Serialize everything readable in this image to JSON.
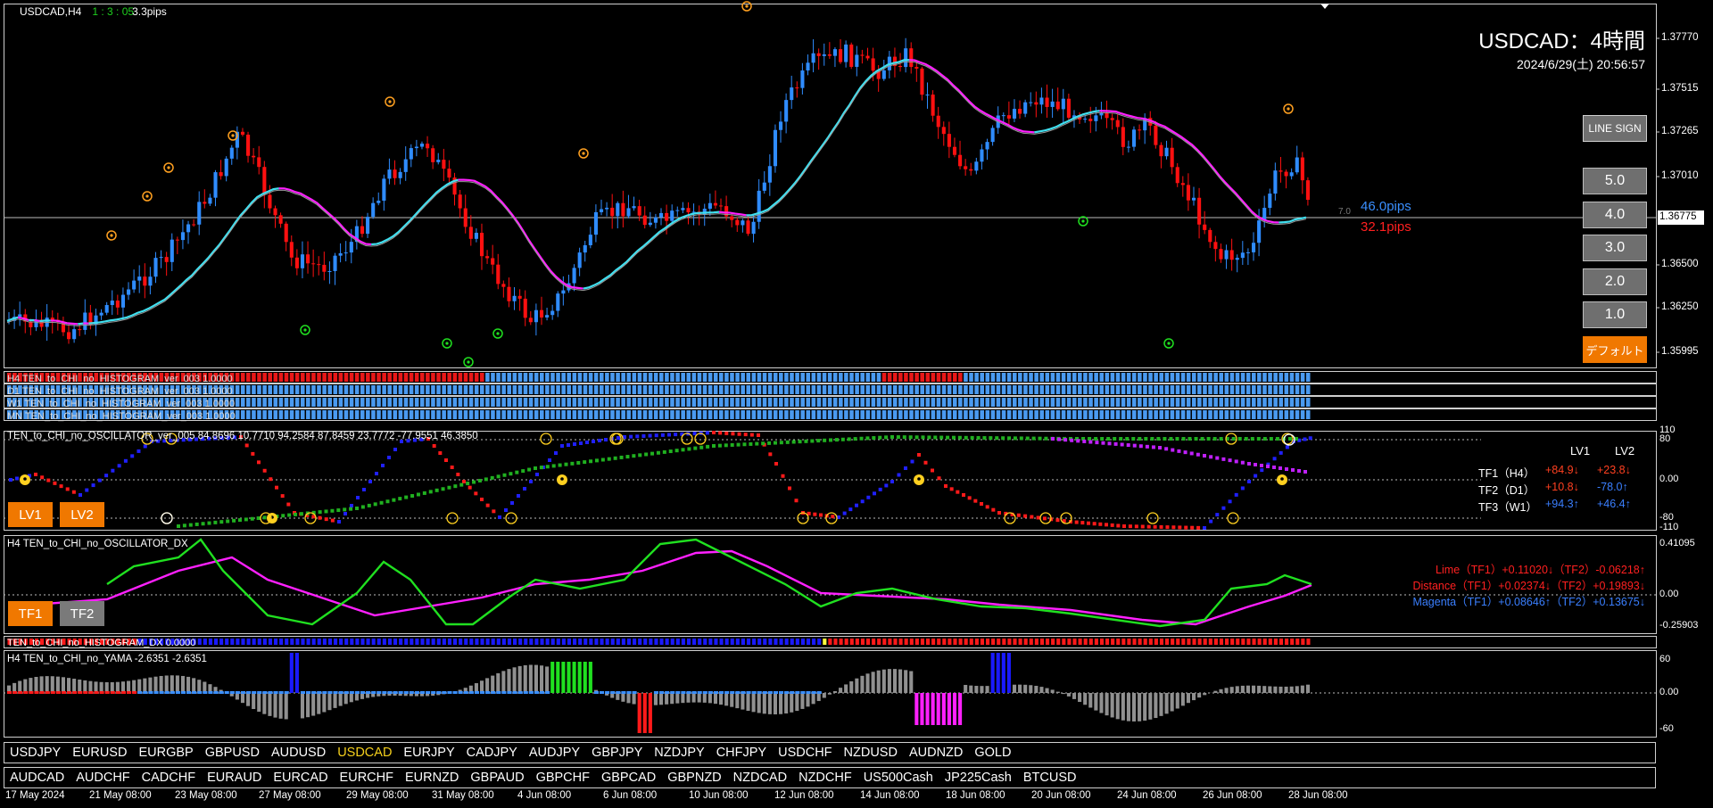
{
  "header": {
    "symbol_tf": "USDCAD,H4",
    "timer": "1 : 3 : 05",
    "spread": "3.3pips",
    "title": "USDCAD：4時間",
    "datetime": "2024/6/29(土) 20:56:57"
  },
  "price_axis": {
    "labels": [
      "1.37770",
      "1.37515",
      "1.37265",
      "1.37010",
      "1.36775",
      "1.36500",
      "1.36250",
      "1.35995"
    ],
    "current_price": "1.36775"
  },
  "pips": {
    "blue": "46.0pips",
    "red": "32.1pips",
    "small": "7.0"
  },
  "buttons": {
    "line_sign": "LINE SIGN",
    "levels": [
      "5.0",
      "4.0",
      "3.0",
      "2.0",
      "1.0"
    ],
    "default": "デフォルト",
    "lv1": "LV1",
    "lv2": "LV2",
    "tf1": "TF1",
    "tf2": "TF2"
  },
  "histograms": [
    "H4 TEN_to_CHI_no_HISTOGRAM_ver_003 1.0000",
    "D1 TEN_to_CHI_no_HISTOGRAM_ver_003 1.0000",
    "W1 TEN_to_CHI_no_HISTOGRAM_ver_003 1.0000",
    "MN TEN_to_CHI_no_HISTOGRAM_ver_003 1.0000"
  ],
  "oscillator": {
    "label": "TEN_to_CHI_no_OSCILLATOR_ver_005 84.8696 10.7710 94.2584 87.8459 23.7772 -77.9551 46.3850",
    "axis": [
      "110",
      "80",
      "0.00",
      "-80",
      "-110"
    ],
    "table_head": [
      "LV1",
      "LV2"
    ],
    "rows": [
      {
        "name": "TF1（H4）",
        "lv1": "+84.9↓",
        "lv2": "+23.8↓"
      },
      {
        "name": "TF2（D1）",
        "lv1": "+10.8↓",
        "lv2": "-78.0↑"
      },
      {
        "name": "TF3（W1）",
        "lv1": "+94.3↑",
        "lv2": "+46.4↑"
      }
    ],
    "colors": {
      "tf1": "#ff4020",
      "tf2": "#3a7fff",
      "tf3": "#3a7fff"
    }
  },
  "dx": {
    "label": "H4 TEN_to_CHI_no_OSCILLATOR_DX",
    "axis": [
      "0.41095",
      "0.00",
      "-0.25903"
    ],
    "lines": [
      {
        "text": "Lime（TF1）+0.11020↓（TF2）-0.06218↑",
        "color": "#ff2020"
      },
      {
        "text": "Distance（TF1）+0.02374↓（TF2）+0.19893↓",
        "color": "#ff2020"
      },
      {
        "text": "Magenta（TF1）+0.08646↑（TF2）+0.13675↓",
        "color": "#3a7fff"
      }
    ]
  },
  "hist_dx_label": "TEN_to_CHI_no_HISTOGRAM_DX 0.0000",
  "yama": {
    "label": "H4  TEN_to_CHI_no_YAMA  -2.6351  -2.6351",
    "axis": [
      "60",
      "0.00",
      "-60"
    ]
  },
  "symbols_row1": [
    "USDJPY",
    "EURUSD",
    "EURGBP",
    "GBPUSD",
    "AUDUSD",
    "USDCAD",
    "EURJPY",
    "CADJPY",
    "AUDJPY",
    "GBPJPY",
    "NZDJPY",
    "CHFJPY",
    "USDCHF",
    "NZDUSD",
    "AUDNZD",
    "GOLD"
  ],
  "symbols_row2": [
    "AUDCAD",
    "AUDCHF",
    "CADCHF",
    "EURAUD",
    "EURCAD",
    "EURCHF",
    "EURNZD",
    "GBPAUD",
    "GBPCHF",
    "GBPCAD",
    "GBPNZD",
    "NZDCAD",
    "NZDCHF",
    "US500Cash",
    "JP225Cash",
    "BTCUSD"
  ],
  "active_symbol": "USDCAD",
  "time_axis": [
    "17 May 2024",
    "21 May 08:00",
    "23 May 08:00",
    "27 May 08:00",
    "29 May 08:00",
    "31 May 08:00",
    "4 Jun 08:00",
    "6 Jun 08:00",
    "10 Jun 08:00",
    "12 Jun 08:00",
    "14 Jun 08:00",
    "18 Jun 08:00",
    "20 Jun 08:00",
    "24 Jun 08:00",
    "26 Jun 08:00",
    "28 Jun 08:00"
  ]
}
